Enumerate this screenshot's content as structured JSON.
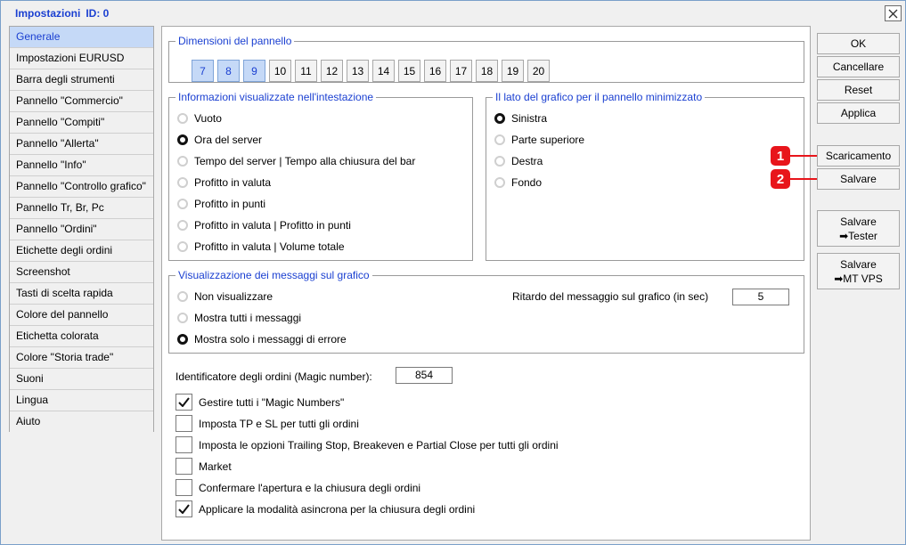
{
  "window": {
    "title": "Impostazioni",
    "id_label": "ID: 0"
  },
  "sidebar": {
    "items": [
      "Generale",
      "Impostazioni EURUSD",
      "Barra degli strumenti",
      "Pannello \"Commercio\"",
      "Pannello \"Compiti\"",
      "Pannello \"Allerta\"",
      "Pannello \"Info\"",
      "Pannello \"Controllo grafico\"",
      "Pannello Tr, Br, Pc",
      "Pannello \"Ordini\"",
      "Etichette degli ordini",
      "Screenshot",
      "Tasti di scelta rapida",
      "Colore del pannello",
      "Etichetta colorata",
      "Colore \"Storia trade\"",
      "Suoni",
      "Lingua",
      "Aiuto"
    ],
    "active_index": 0
  },
  "panel_size": {
    "title": "Dimensioni del pannello",
    "sizes": [
      "7",
      "8",
      "9",
      "10",
      "11",
      "12",
      "13",
      "14",
      "15",
      "16",
      "17",
      "18",
      "19",
      "20"
    ],
    "selected": [
      "7",
      "8",
      "9"
    ]
  },
  "header_info": {
    "title": "Informazioni visualizzate nell'intestazione",
    "options": [
      "Vuoto",
      "Ora del server",
      "Tempo del server | Tempo alla chiusura del bar",
      "Profitto in valuta",
      "Profitto in punti",
      "Profitto in valuta | Profitto in punti",
      "Profitto in valuta | Volume totale"
    ],
    "selected_index": 1
  },
  "minimized_side": {
    "title": "Il lato del grafico per il pannello minimizzato",
    "options": [
      "Sinistra",
      "Parte superiore",
      "Destra",
      "Fondo"
    ],
    "selected_index": 0
  },
  "messages": {
    "title": "Visualizzazione dei messaggi sul grafico",
    "options": [
      "Non visualizzare",
      "Mostra tutti i messaggi",
      "Mostra solo i messaggi di errore"
    ],
    "selected_index": 2,
    "delay_label": "Ritardo del messaggio sul grafico (in sec)",
    "delay_value": "5"
  },
  "magic": {
    "label": "Identificatore degli ordini (Magic number):",
    "value": "854"
  },
  "checkboxes": [
    {
      "label": "Gestire tutti i \"Magic Numbers\"",
      "checked": true
    },
    {
      "label": "Imposta TP e SL per tutti gli ordini",
      "checked": false
    },
    {
      "label": "Imposta le opzioni Trailing Stop, Breakeven e Partial Close per tutti gli ordini",
      "checked": false
    },
    {
      "label": "Market",
      "checked": false
    },
    {
      "label": "Confermare l'apertura e la chiusura degli ordini",
      "checked": false
    },
    {
      "label": "Applicare la modalità asincrona per la chiusura degli ordini",
      "checked": true
    }
  ],
  "buttons": {
    "ok": "OK",
    "cancel": "Cancellare",
    "reset": "Reset",
    "apply": "Applica",
    "download": "Scaricamento",
    "save": "Salvare",
    "save_tester_line1": "Salvare",
    "save_tester_line2": "➡Tester",
    "save_vps_line1": "Salvare",
    "save_vps_line2": "➡MT VPS"
  },
  "markers": [
    "1",
    "2"
  ],
  "colors": {
    "accent": "#1a3fd1",
    "selected_bg": "#c5d9f7",
    "marker": "#e8151b"
  }
}
